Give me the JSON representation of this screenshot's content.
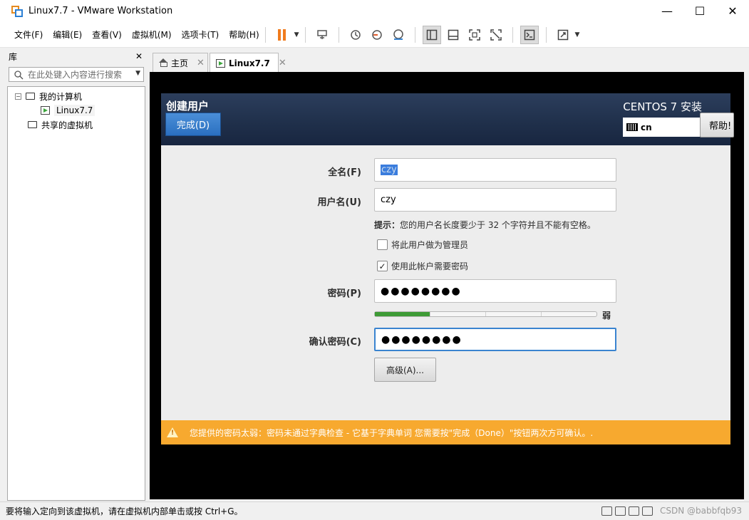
{
  "window": {
    "title": "Linux7.7 - VMware Workstation",
    "min": "—",
    "max": "☐",
    "close": "✕"
  },
  "menu": [
    "文件(F)",
    "编辑(E)",
    "查看(V)",
    "虚拟机(M)",
    "选项卡(T)",
    "帮助(H)"
  ],
  "library": {
    "title": "库",
    "close": "✕",
    "search_placeholder": "在此处键入内容进行搜索",
    "tree": {
      "my_computer": "我的计算机",
      "vm": "Linux7.7",
      "shared": "共享的虚拟机"
    }
  },
  "tabs": [
    {
      "label": "主页",
      "close": "✕"
    },
    {
      "label": "Linux7.7",
      "close": "✕"
    }
  ],
  "installer": {
    "title": "创建用户",
    "done_button": "完成(D)",
    "product": "CENTOS 7 安装",
    "keyboard": "cn",
    "help_button": "帮助!",
    "fullname_label": "全名(F)",
    "fullname_value": "czy",
    "username_label": "用户名(U)",
    "username_value": "czy",
    "hint_prefix": "提示：",
    "hint_text": "您的用户名长度要少于 32 个字符并且不能有空格。",
    "admin_checkbox": "将此用户做为管理员",
    "admin_checked": false,
    "require_password_checkbox": "使用此帐户需要密码",
    "require_password_checked": true,
    "password_label": "密码(P)",
    "password_value": "●●●●●●●●",
    "strength_fraction": 0.25,
    "strength_label": "弱",
    "confirm_label": "确认密码(C)",
    "confirm_value": "●●●●●●●●",
    "advanced_button": "高级(A)...",
    "warning": "您提供的密码太弱：密码未通过字典检查 - 它基于字典单词 您需要按\"完成（Done）\"按钮两次方可确认。."
  },
  "status": {
    "message": "要将输入定向到该虚拟机，请在虚拟机内部单击或按 Ctrl+G。",
    "watermark": "CSDN @babbfqb93"
  }
}
